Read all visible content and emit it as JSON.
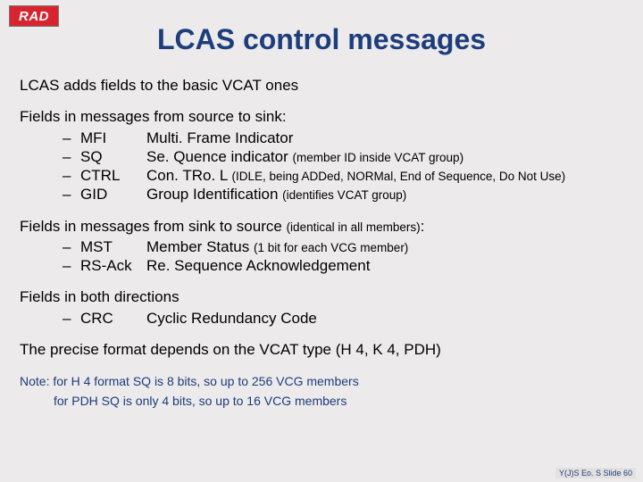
{
  "logo": "RAD",
  "title": "LCAS control messages",
  "intro": "LCAS adds fields to the basic VCAT ones",
  "src_heading": "Fields in messages from source to sink:",
  "src_fields": [
    {
      "abbr": "MFI",
      "desc": "Multi. Frame Indicator",
      "paren": ""
    },
    {
      "abbr": "SQ",
      "desc": "Se. Quence indicator",
      "paren": "(member ID inside VCAT group)"
    },
    {
      "abbr": "CTRL",
      "desc": "Con. TRo. L",
      "paren": "(IDLE, being ADDed, NORMal, End of Sequence, Do Not Use)"
    },
    {
      "abbr": "GID",
      "desc": "Group Identification",
      "paren": "(identifies VCAT group)"
    }
  ],
  "sink_heading_a": "Fields in messages from sink to source ",
  "sink_heading_b": "(identical in all members)",
  "sink_heading_c": ":",
  "sink_fields": [
    {
      "abbr": "MST",
      "desc": "Member Status",
      "paren": "(1 bit for each VCG member)"
    },
    {
      "abbr": "RS-Ack",
      "desc": "Re. Sequence Acknowledgement",
      "paren": ""
    }
  ],
  "both_heading": "Fields in both directions",
  "both_fields": [
    {
      "abbr": "CRC",
      "desc": "Cyclic Redundancy Code",
      "paren": ""
    }
  ],
  "precise": "The precise format depends on the VCAT type (H 4, K 4, PDH)",
  "note1": "Note: for H 4 format SQ is 8 bits, so up to 256 VCG members",
  "note2": "for PDH SQ is only 4 bits, so up to 16 VCG members",
  "footer": "Y(J)S Eo. S   Slide 60"
}
